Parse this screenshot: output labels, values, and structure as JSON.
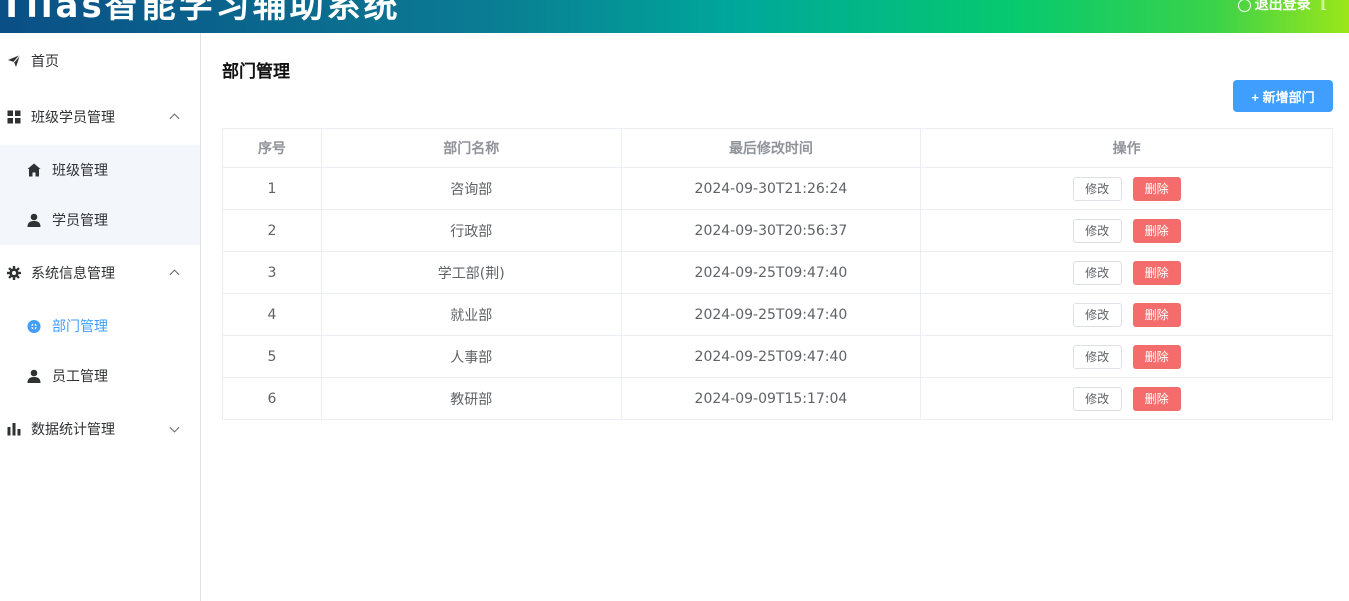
{
  "header": {
    "title": "Tlias智能学习辅助系统",
    "logout_label": "退出登录",
    "logout_icon": "power-icon",
    "exit_icon": "logout-door-icon"
  },
  "sidebar": {
    "items": [
      {
        "label": "首页",
        "icon": "paper-plane-icon"
      },
      {
        "label": "班级学员管理",
        "icon": "grid-icon",
        "expanded": true
      },
      {
        "label": "班级管理",
        "icon": "house-icon"
      },
      {
        "label": "学员管理",
        "icon": "user-icon"
      },
      {
        "label": "系统信息管理",
        "icon": "gear-icon",
        "expanded": true
      },
      {
        "label": "部门管理",
        "icon": "circle-plus-icon",
        "active": true
      },
      {
        "label": "员工管理",
        "icon": "user-icon"
      },
      {
        "label": "数据统计管理",
        "icon": "bar-chart-icon",
        "expanded": false
      }
    ]
  },
  "main": {
    "title": "部门管理",
    "add_button": "+ 新增部门",
    "table": {
      "headers": [
        "序号",
        "部门名称",
        "最后修改时间",
        "操作"
      ],
      "rows": [
        {
          "index": "1",
          "name": "咨询部",
          "updated": "2024-09-30T21:26:24"
        },
        {
          "index": "2",
          "name": "行政部",
          "updated": "2024-09-30T20:56:37"
        },
        {
          "index": "3",
          "name": "学工部(荆)",
          "updated": "2024-09-25T09:47:40"
        },
        {
          "index": "4",
          "name": "就业部",
          "updated": "2024-09-25T09:47:40"
        },
        {
          "index": "5",
          "name": "人事部",
          "updated": "2024-09-25T09:47:40"
        },
        {
          "index": "6",
          "name": "教研部",
          "updated": "2024-09-09T15:17:04"
        }
      ],
      "edit_label": "修改",
      "delete_label": "删除"
    }
  },
  "colors": {
    "primary": "#409eff",
    "danger": "#f56c6c",
    "header_gradient_start": "#0a4f86",
    "header_gradient_end": "#9be61a"
  }
}
